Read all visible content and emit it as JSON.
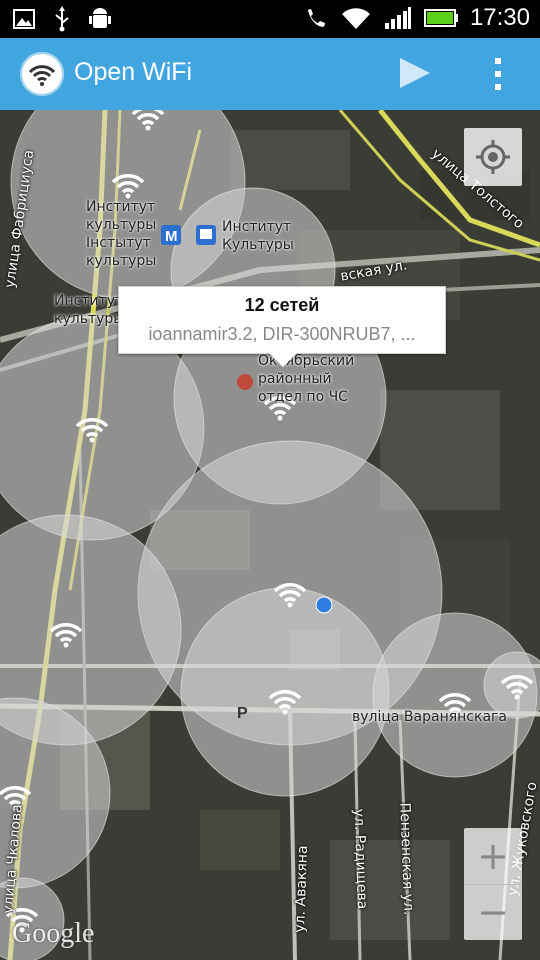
{
  "status_bar": {
    "time": "17:30",
    "icons": [
      "picture-icon",
      "usb-icon",
      "android-debug-icon",
      "phone-silent-icon",
      "wifi-signal-icon",
      "cell-signal-icon",
      "battery-icon"
    ]
  },
  "app_bar": {
    "title": "Open WiFi",
    "play_icon": "play-icon",
    "menu_icon": "overflow-menu-icon",
    "accent": "#41a6e0"
  },
  "popup": {
    "title": "12 сетей",
    "networks": "ioannamir3.2, DIR-300NRUB7, ..."
  },
  "map": {
    "attribution": "Google",
    "zoom_in": "+",
    "zoom_out": "−",
    "labels": {
      "inst1": "Институт\nкультуры\nIнстытут\nкультуры",
      "inst2": "Институт\nКультуры",
      "inst3": "Институт\nкультуры",
      "fire": "Октябрьский\nрайонный\nотдел по ЧС",
      "fabr": "улица Фабрициуса",
      "tolst": "улица Толстого",
      "vsk": "вская ул.",
      "varan": "вуліца Варанянскага",
      "chkalova": "улица Чкалова",
      "avakyan": "ул. Авакяна",
      "radish": "ул. Радищева",
      "penz": "Пензенская ул.",
      "zhuk": "ул. Жуковского",
      "parking": "P",
      "metro": "M"
    }
  }
}
